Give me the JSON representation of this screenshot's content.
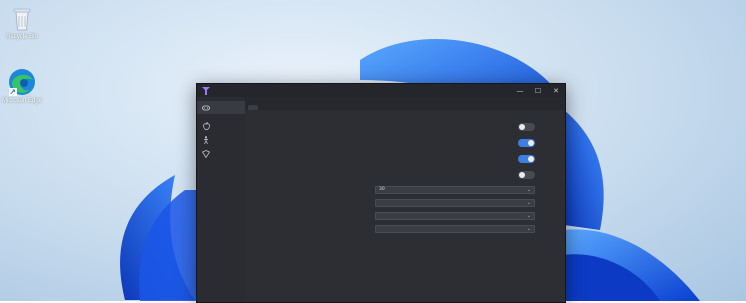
{
  "desktop": {
    "icons": [
      {
        "name": "recycle-bin",
        "label": "Recycle Bin"
      },
      {
        "name": "microsoft-edge",
        "label": "Microsoft Edge"
      }
    ]
  },
  "window": {
    "title": "",
    "controls": {
      "minimize": "—",
      "maximize": "☐",
      "close": "✕"
    }
  },
  "sidebar": {
    "items": [
      {
        "label": "",
        "icon": "gamepad-icon"
      },
      {
        "label": "",
        "icon": "apple-icon"
      },
      {
        "label": "",
        "icon": "figure-icon"
      },
      {
        "label": "",
        "icon": "shield-icon"
      }
    ]
  },
  "tabs": [
    "",
    ""
  ],
  "settings": {
    "toggles": [
      {
        "label": "",
        "state": "off"
      },
      {
        "label": "",
        "state": "on"
      },
      {
        "label": "",
        "state": "on"
      },
      {
        "label": "",
        "state": "off"
      }
    ],
    "selects": [
      {
        "label": "",
        "value": "30"
      },
      {
        "label": "",
        "value": ""
      },
      {
        "label": "",
        "value": ""
      },
      {
        "label": "",
        "value": ""
      }
    ]
  },
  "colors": {
    "accent": "#3d7fe3",
    "window_bg": "#2a2c31",
    "titlebar_bg": "#24262b"
  }
}
